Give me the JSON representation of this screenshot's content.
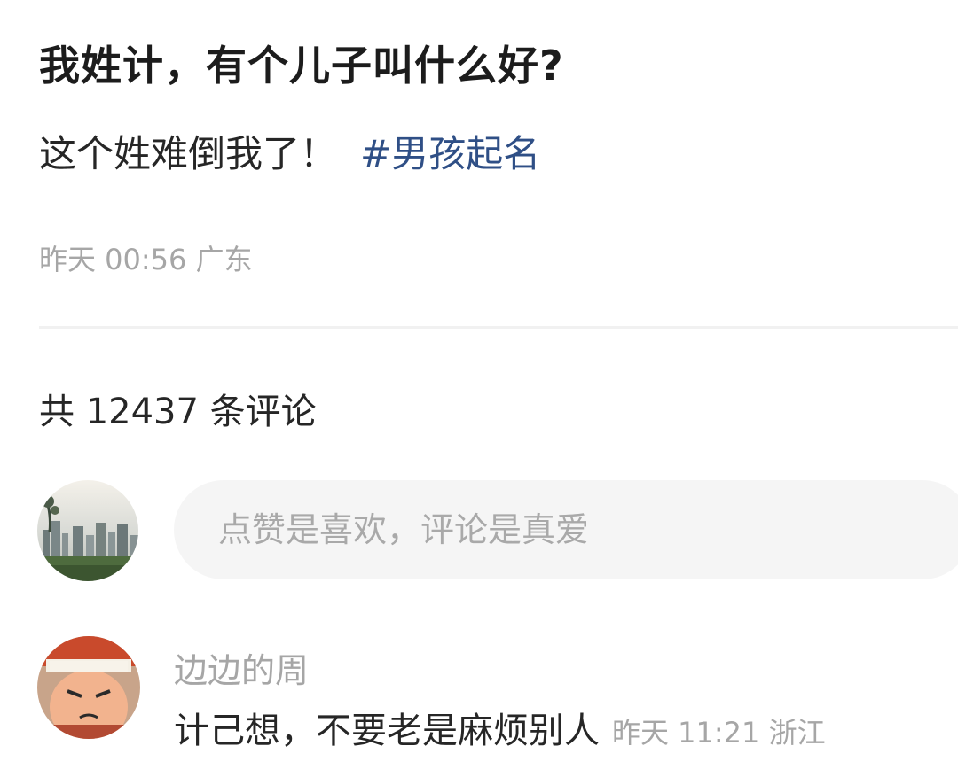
{
  "post": {
    "title": "我姓计，有个儿子叫什么好?",
    "body": "这个姓难倒我了！",
    "hashtag": "#男孩起名",
    "meta": "昨天 00:56 广东"
  },
  "comments": {
    "count_label": "共 12437 条评论",
    "input_placeholder": "点赞是喜欢，评论是真爱",
    "items": [
      {
        "author": "边边的周",
        "text": "计己想，不要老是麻烦别人",
        "meta": "昨天 11:21 浙江"
      }
    ]
  },
  "colors": {
    "hashtag": "#2f4f86",
    "meta_text": "#a6a6a6",
    "input_bg": "#f5f5f5"
  }
}
